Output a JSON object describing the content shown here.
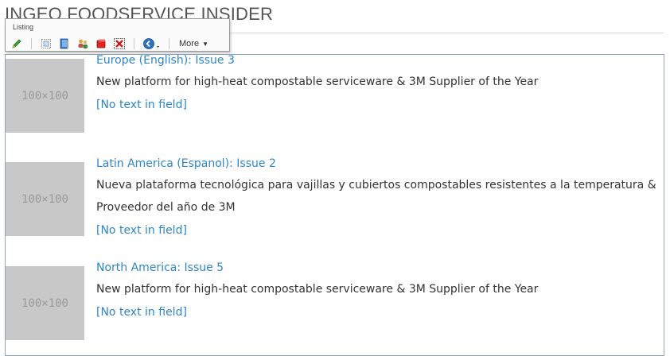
{
  "page": {
    "title": "INGEO FOODSERVICE INSIDER"
  },
  "toolbar": {
    "label": "Listing",
    "more_label": "More",
    "buttons": [
      {
        "name": "edit-pencil-icon"
      },
      {
        "name": "insert-item-icon"
      },
      {
        "name": "publish-book-icon"
      },
      {
        "name": "users-icon"
      },
      {
        "name": "delete-red-icon"
      },
      {
        "name": "remove-x-icon"
      },
      {
        "name": "navigate-circle-icon"
      }
    ]
  },
  "thumb_placeholder": "100×100",
  "items": [
    {
      "title": "Europe (English): Issue 3",
      "description_lines": [
        "New platform for high-heat compostable serviceware & 3M Supplier of the Year"
      ],
      "empty_field": "[No text in field]"
    },
    {
      "title": "Latin America (Espanol): Issue 2",
      "description_lines": [
        "Nueva plataforma tecnológica para vajillas y cubiertos compostables resistentes a la temperatura &",
        "Proveedor del año de 3M"
      ],
      "empty_field": "[No text in field]"
    },
    {
      "title": "North America: Issue 5",
      "description_lines": [
        "New platform for high-heat compostable serviceware & 3M Supplier of the Year"
      ],
      "empty_field": "[No text in field]"
    }
  ],
  "colors": {
    "link": "#2e86c7",
    "body_text": "#333333",
    "thumb_bg": "#c8c8c8",
    "frame_border": "#8ea4bf"
  }
}
